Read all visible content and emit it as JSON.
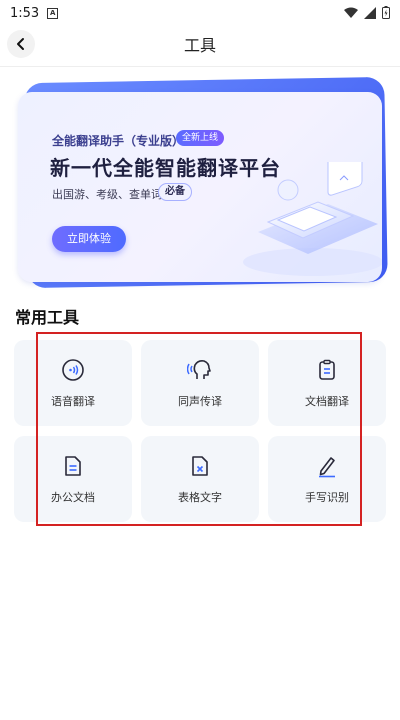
{
  "status_bar": {
    "time": "1:53",
    "notification_glyph": "A"
  },
  "header": {
    "title": "工具"
  },
  "banner": {
    "app_name": "全能翻译助手（专业版）",
    "badge": "全新上线",
    "headline": "新一代全能智能翻译平台",
    "subtitle": "出国游、考级、查单词",
    "subtitle_tag": "必备",
    "cta": "立即体验"
  },
  "tools_section": {
    "title": "常用工具",
    "items": [
      {
        "label": "语音翻译",
        "icon": "voice-translate-icon"
      },
      {
        "label": "同声传译",
        "icon": "simultaneous-interpret-icon"
      },
      {
        "label": "文档翻译",
        "icon": "document-translate-icon"
      },
      {
        "label": "办公文档",
        "icon": "office-document-icon"
      },
      {
        "label": "表格文字",
        "icon": "table-text-icon"
      },
      {
        "label": "手写识别",
        "icon": "handwriting-icon"
      }
    ]
  },
  "colors": {
    "accent": "#4f6bff",
    "highlight_border": "#d42222",
    "tile_bg": "#f3f6fa"
  }
}
